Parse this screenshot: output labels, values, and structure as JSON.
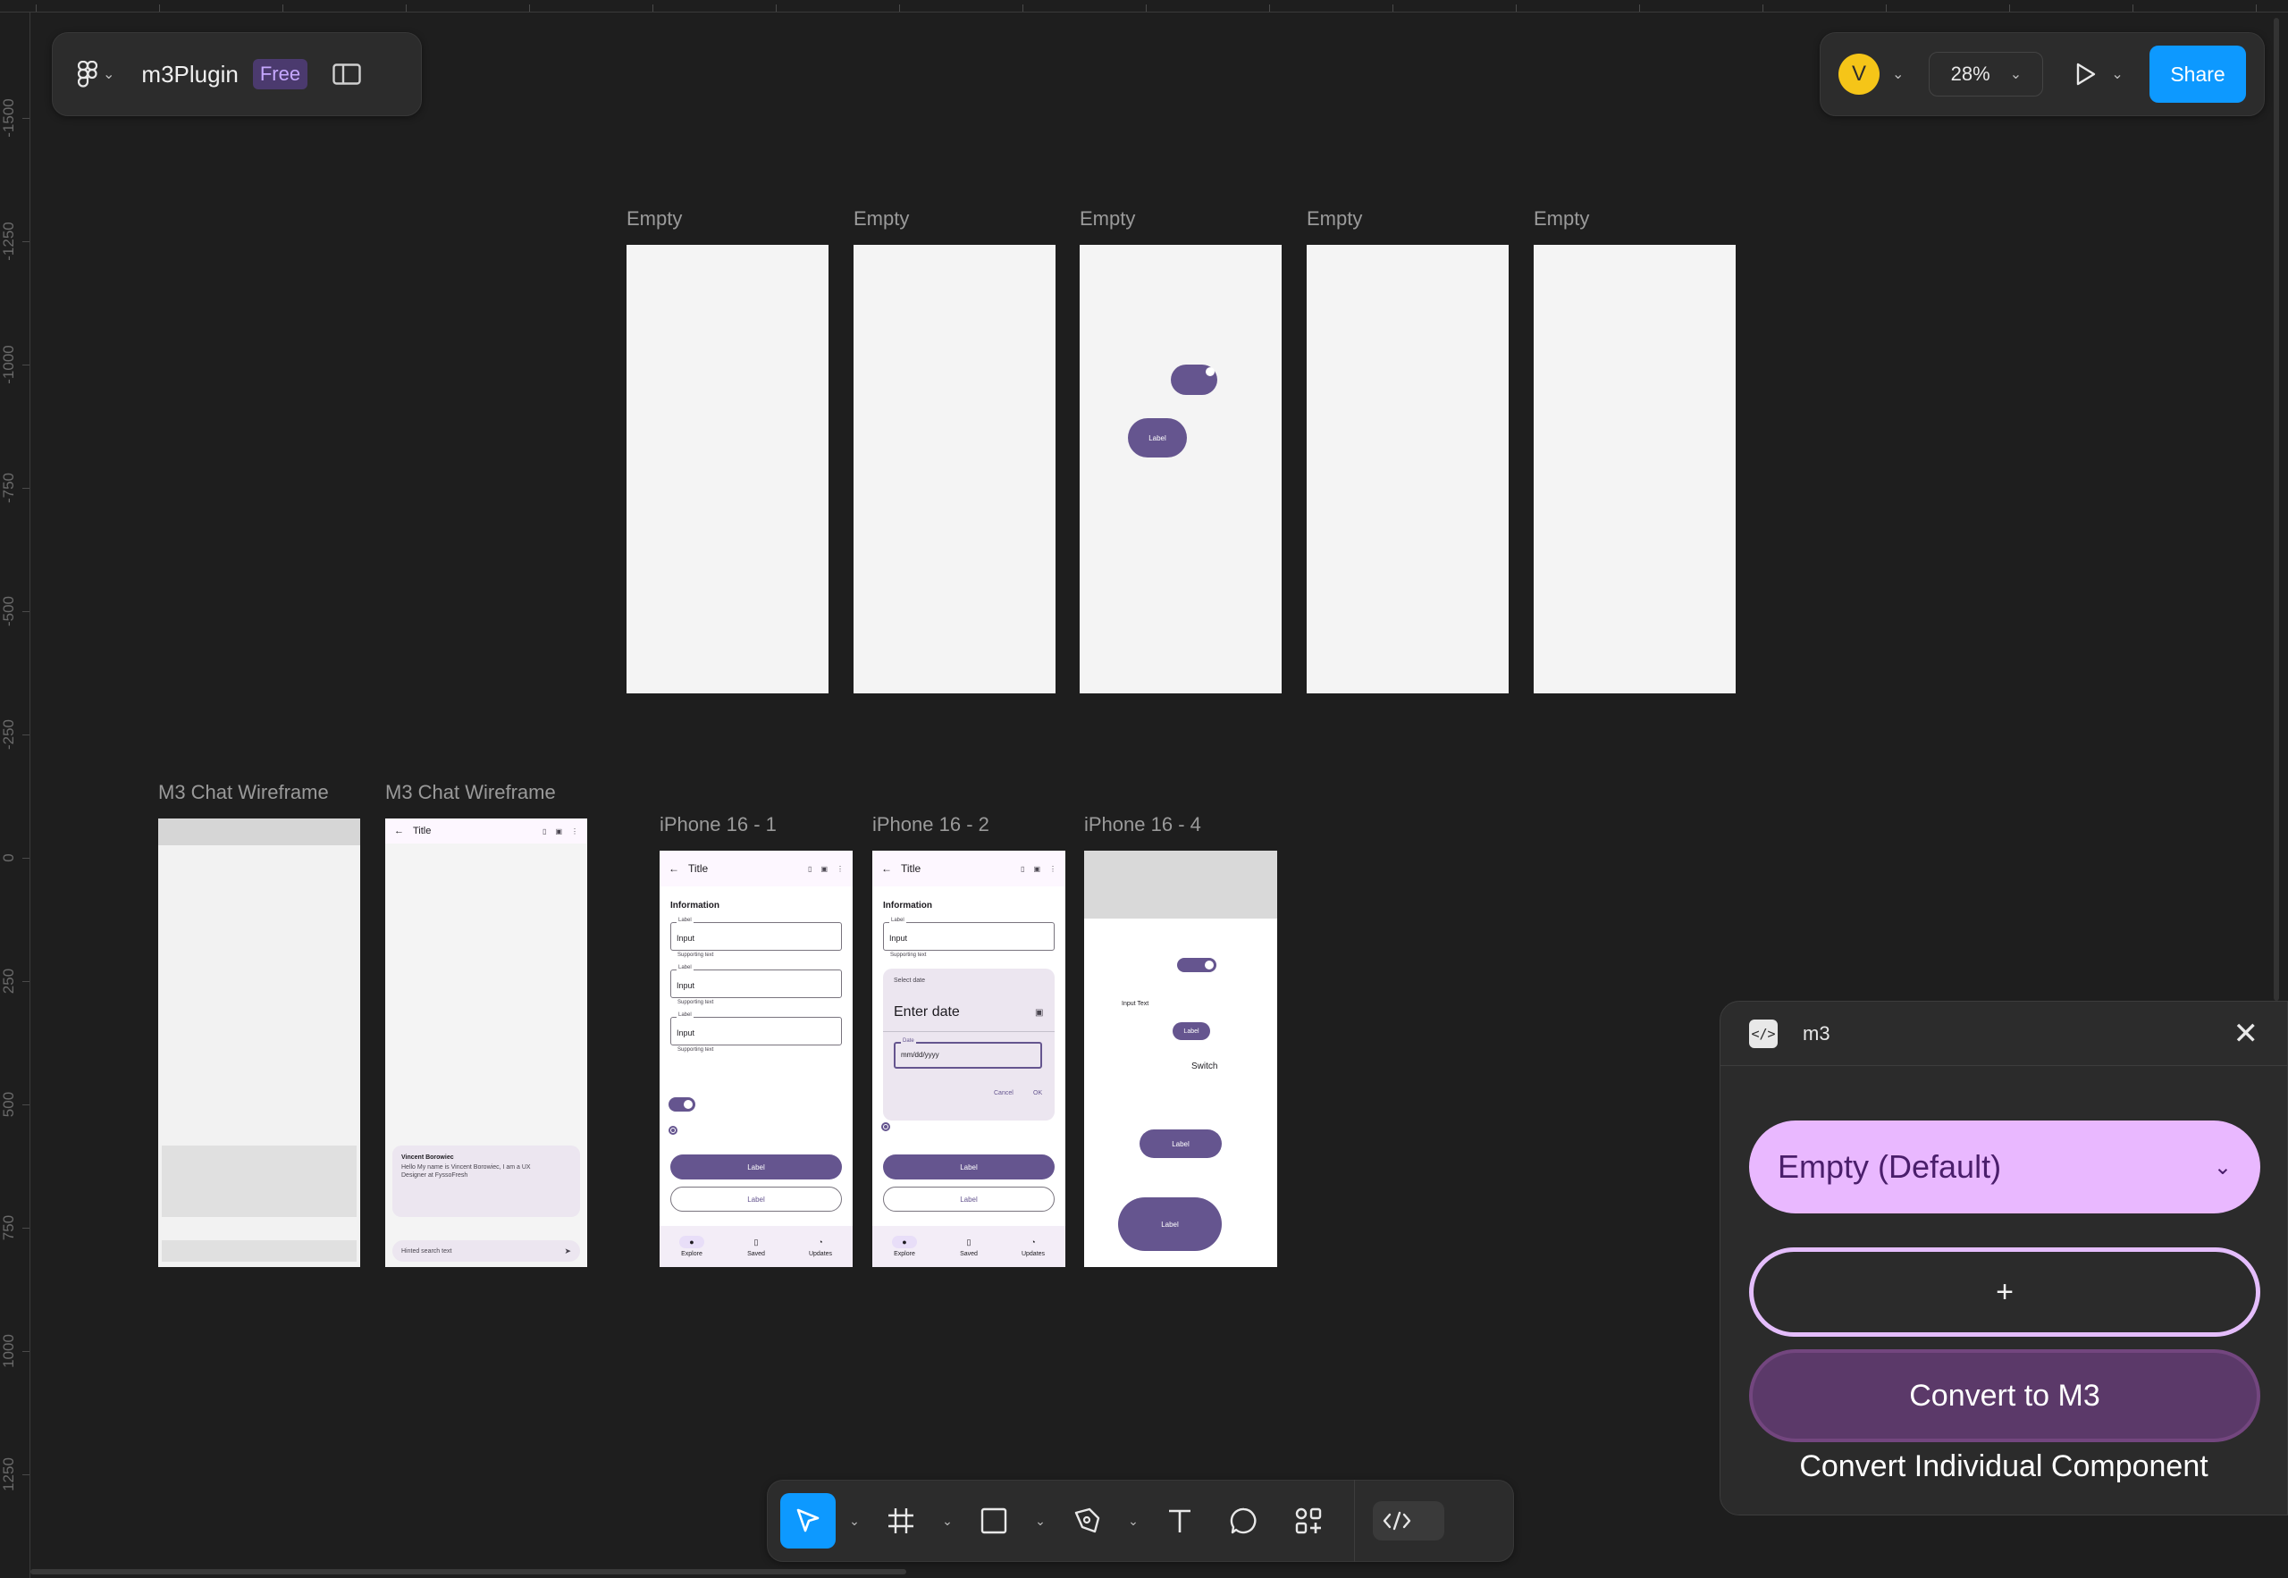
{
  "ruler_left": [
    "-1500",
    "-1250",
    "-1000",
    "-750",
    "-500",
    "-250",
    "0",
    "250",
    "500",
    "750",
    "1000",
    "1250"
  ],
  "file": {
    "name": "m3Plugin",
    "plan_badge": "Free"
  },
  "right_toolbar": {
    "avatar_initial": "V",
    "zoom": "28%",
    "share_label": "Share"
  },
  "frames": {
    "empty_1": "Empty",
    "empty_2": "Empty",
    "empty_3": "Empty",
    "empty_4": "Empty",
    "empty_5": "Empty",
    "chat_1": "M3 Chat Wireframe",
    "chat_2": "M3 Chat Wireframe",
    "iphone_1": "iPhone 16 - 1",
    "iphone_2": "iPhone 16 - 2",
    "iphone_4": "iPhone 16 - 4"
  },
  "mini": {
    "label": "Label",
    "appbar_title": "Title",
    "information": "Information",
    "field_label": "Label",
    "field_value": "Input",
    "supporting": "Supporting text",
    "chat_name": "Vincent Borowiec",
    "chat_message": "Hello My name is Vincent Borowiec, I am a UX Designer at FyssoFresh",
    "chat_input": "Hinted search text",
    "nav": [
      "Explore",
      "Saved",
      "Updates"
    ],
    "select_date": "Select date",
    "enter_date": "Enter date",
    "date_label": "Date",
    "date_placeholder": "mm/dd/yyyy",
    "cancel": "Cancel",
    "ok": "OK",
    "input_text": "Input Text",
    "switch": "Switch"
  },
  "plugin": {
    "title": "m3",
    "variant_selected": "Empty (Default)",
    "add_label": "+",
    "convert_label": "Convert to M3",
    "convert_individual_label": "Convert Individual Component"
  },
  "colors": {
    "accent": "#0d99ff",
    "m3_primary": "#65558f",
    "plugin_select": "#e9b8ff",
    "plugin_convert": "#5b3969"
  },
  "tools": [
    "move-tool",
    "frame-tool",
    "rectangle-tool",
    "pen-tool",
    "text-tool",
    "comment-tool",
    "actions-tool",
    "dev-mode-toggle"
  ]
}
